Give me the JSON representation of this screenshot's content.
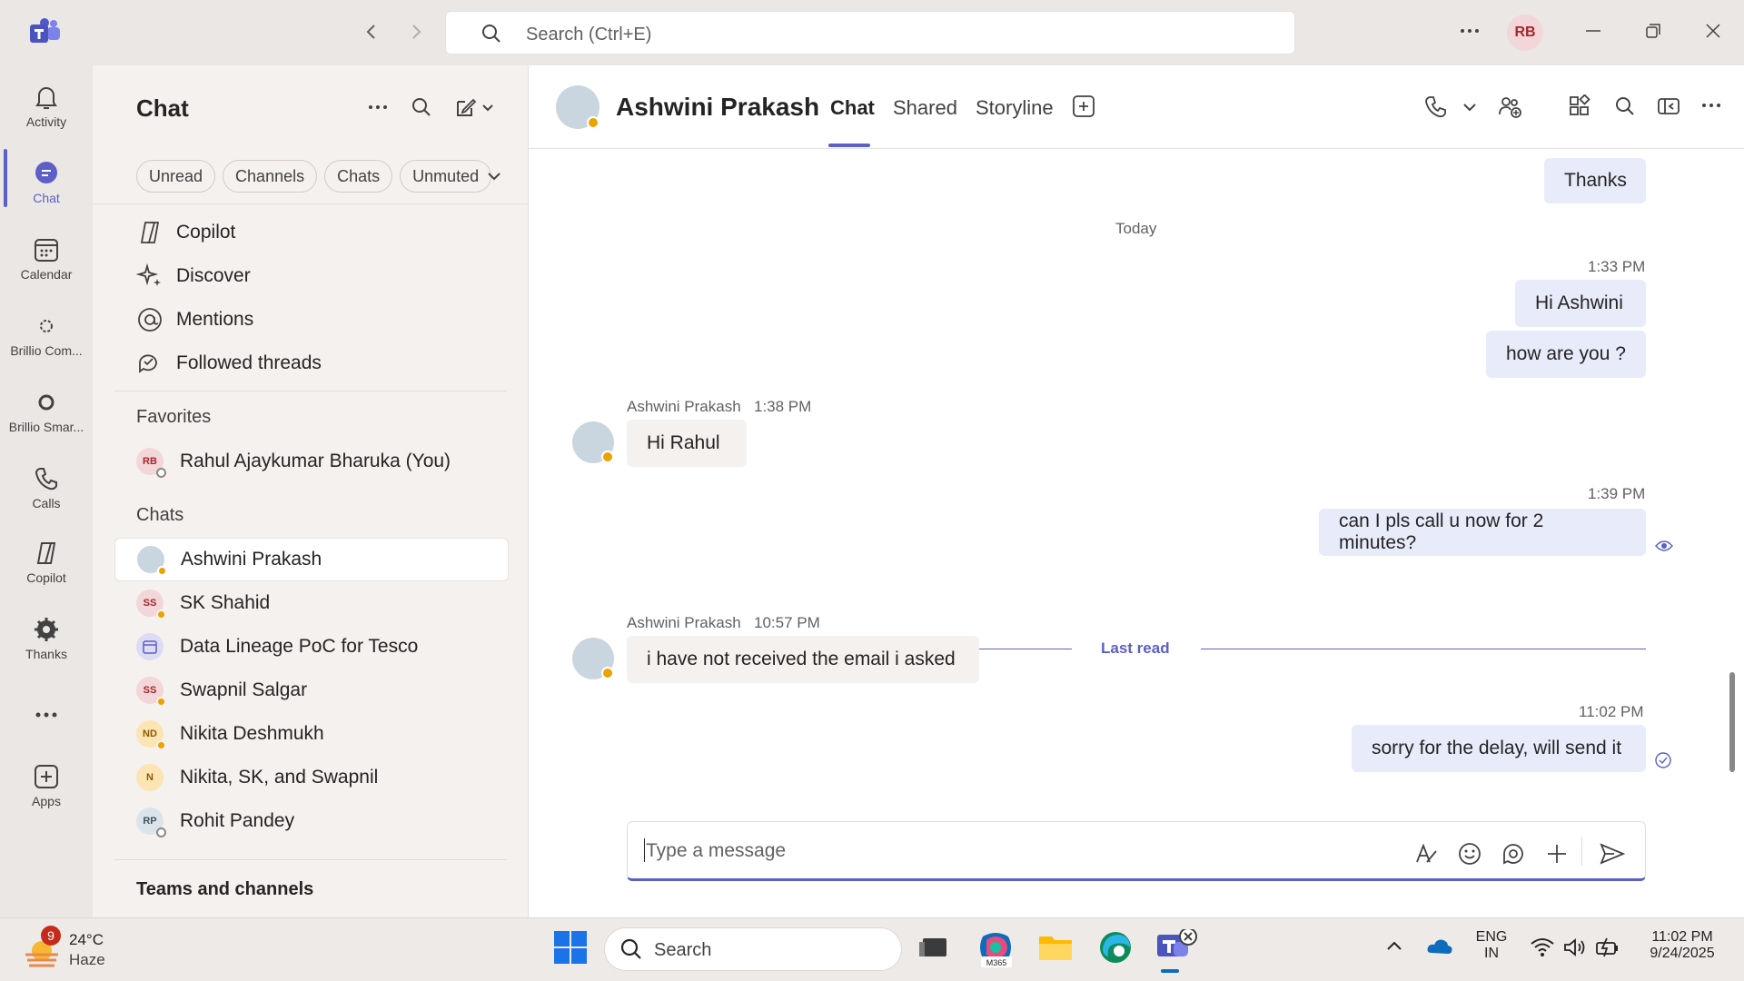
{
  "search": {
    "placeholder": "Search (Ctrl+E)"
  },
  "user": {
    "initials": "RB"
  },
  "rail": [
    {
      "label": "Activity",
      "icon": "bell-icon"
    },
    {
      "label": "Chat",
      "icon": "chat-icon"
    },
    {
      "label": "Calendar",
      "icon": "calendar-icon"
    },
    {
      "label": "Brillio Com...",
      "icon": "app-icon"
    },
    {
      "label": "Brillio Smar...",
      "icon": "app-icon"
    },
    {
      "label": "Calls",
      "icon": "phone-icon"
    },
    {
      "label": "Copilot",
      "icon": "copilot-icon"
    },
    {
      "label": "Thanks",
      "icon": "thanks-icon"
    },
    {
      "label": "Apps",
      "icon": "add-icon"
    }
  ],
  "sidebar": {
    "title": "Chat",
    "filters": [
      "Unread",
      "Channels",
      "Chats",
      "Unmuted"
    ],
    "nav": [
      {
        "label": "Copilot",
        "icon": "copilot-icon"
      },
      {
        "label": "Discover",
        "icon": "sparkle-icon"
      },
      {
        "label": "Mentions",
        "icon": "at-icon"
      },
      {
        "label": "Followed threads",
        "icon": "threads-icon"
      }
    ],
    "favorites_label": "Favorites",
    "favorites": [
      {
        "name": "Rahul Ajaykumar Bharuka (You)",
        "initials": "RB"
      }
    ],
    "chats_label": "Chats",
    "chats": [
      {
        "name": "Ashwini Prakash",
        "initials": ""
      },
      {
        "name": "SK Shahid",
        "initials": "SS"
      },
      {
        "name": "Data Lineage PoC for Tesco",
        "initials": ""
      },
      {
        "name": "Swapnil Salgar",
        "initials": "SS"
      },
      {
        "name": "Nikita Deshmukh",
        "initials": "ND"
      },
      {
        "name": "Nikita, SK, and Swapnil",
        "initials": "N"
      },
      {
        "name": "Rohit Pandey",
        "initials": "RP"
      }
    ],
    "teams_label": "Teams and channels"
  },
  "header": {
    "name": "Ashwini Prakash",
    "tabs": [
      "Chat",
      "Shared",
      "Storyline"
    ]
  },
  "messages": {
    "thanks": "Thanks",
    "today": "Today",
    "t1": "1:33 PM",
    "m1": "Hi Ashwini",
    "m2": "how are you ?",
    "in1_meta": "Ashwini Prakash",
    "in1_time": "1:38 PM",
    "in1": "Hi Rahul",
    "t2": "1:39 PM",
    "m3": "can I pls call u now for 2 minutes?",
    "last_read": "Last read",
    "in2_meta": "Ashwini Prakash",
    "in2_time": "10:57 PM",
    "in2": "i have not received the email i asked",
    "t3": "11:02 PM",
    "m4": "sorry for the delay, will send it"
  },
  "composer": {
    "placeholder": "Type a message"
  },
  "taskbar": {
    "weather_temp": "24°C",
    "weather_desc": "Haze",
    "weather_badge": "9",
    "search": "Search",
    "m365_label": "M365",
    "lang1": "ENG",
    "lang2": "IN",
    "time": "11:02 PM",
    "date": "9/24/2025"
  },
  "colors": {
    "accent": "#5b5fc7",
    "bubble_out": "#e8ebfa",
    "bubble_in": "#f5f1ef",
    "status_away": "#eaa300"
  }
}
